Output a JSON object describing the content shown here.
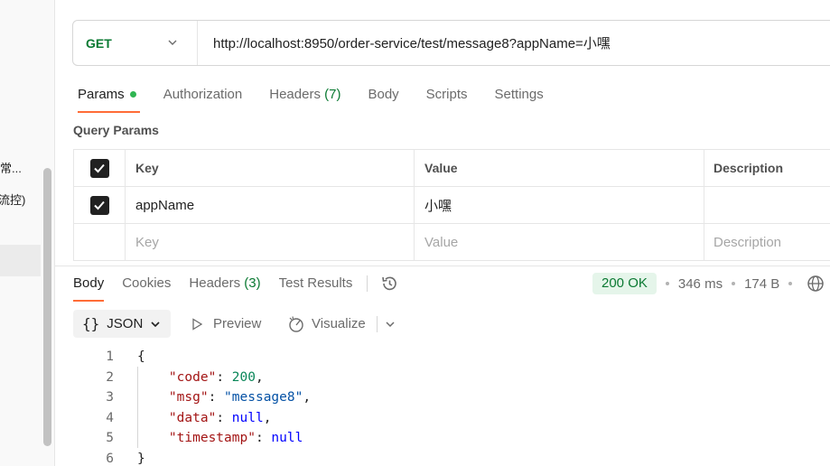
{
  "sidebar": {
    "items": [
      "常...",
      "流控)"
    ]
  },
  "request": {
    "method": "GET",
    "url": "http://localhost:8950/order-service/test/message8?appName=小嘿"
  },
  "request_tabs": [
    {
      "label": "Params",
      "count": "",
      "active": true
    },
    {
      "label": "Authorization",
      "count": ""
    },
    {
      "label": "Headers",
      "count": "(7)"
    },
    {
      "label": "Body",
      "count": ""
    },
    {
      "label": "Scripts",
      "count": ""
    },
    {
      "label": "Settings",
      "count": ""
    }
  ],
  "query_params": {
    "title": "Query Params",
    "headers": {
      "key": "Key",
      "value": "Value",
      "description": "Description"
    },
    "rows": [
      {
        "checked": true,
        "key": "appName",
        "value": "小嘿",
        "description": ""
      }
    ],
    "placeholder": {
      "key": "Key",
      "value": "Value",
      "description": "Description"
    }
  },
  "response_tabs": [
    {
      "label": "Body",
      "count": "",
      "active": true
    },
    {
      "label": "Cookies",
      "count": ""
    },
    {
      "label": "Headers",
      "count": "(3)"
    },
    {
      "label": "Test Results",
      "count": ""
    }
  ],
  "response_stats": {
    "status": "200 OK",
    "time": "346 ms",
    "size": "174 B",
    "status_color": "#0b7a33"
  },
  "body_toolbar": {
    "format": "JSON",
    "preview": "Preview",
    "visualize": "Visualize"
  },
  "response_body": {
    "line_numbers": [
      "1",
      "2",
      "3",
      "4",
      "5",
      "6"
    ],
    "open_brace": "{",
    "close_brace": "}",
    "fields": [
      {
        "key": "\"code\"",
        "value": "200",
        "type": "number"
      },
      {
        "key": "\"msg\"",
        "value": "\"message8\"",
        "type": "string"
      },
      {
        "key": "\"data\"",
        "value": "null",
        "type": "literal"
      },
      {
        "key": "\"timestamp\"",
        "value": "null",
        "type": "literal"
      }
    ]
  },
  "colors": {
    "accent": "#ff6c37",
    "get_method": "#0b7a33"
  }
}
